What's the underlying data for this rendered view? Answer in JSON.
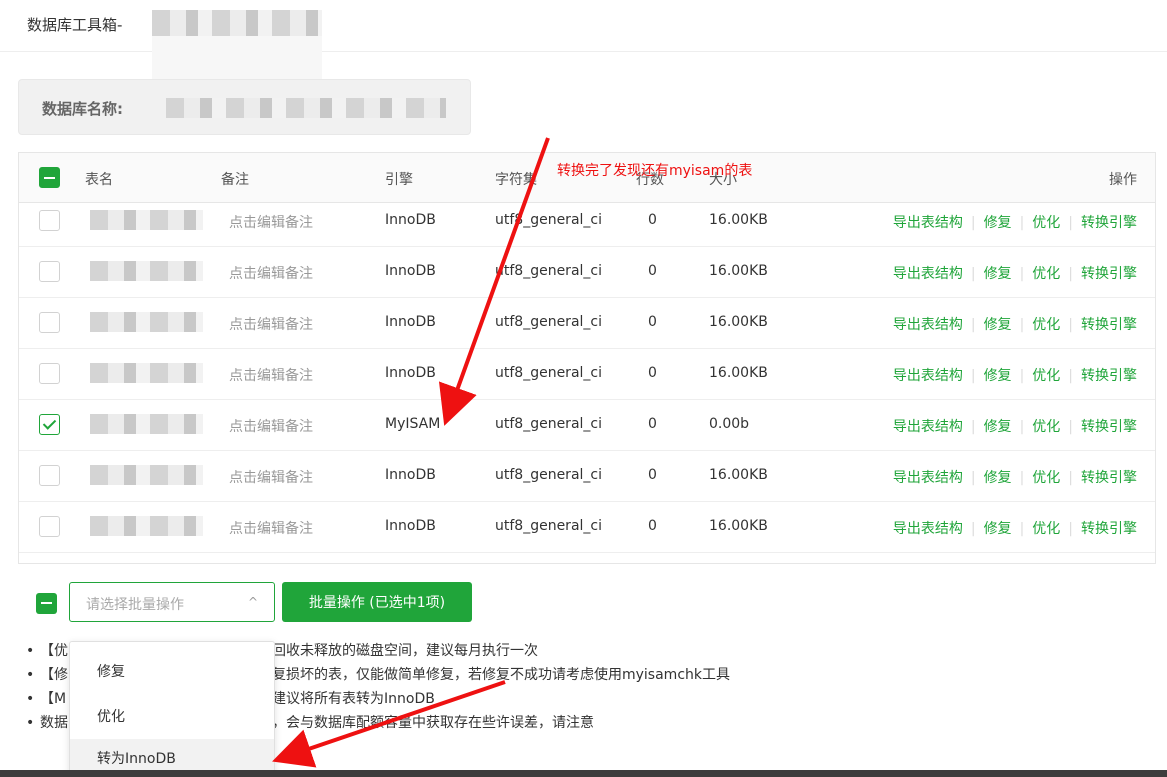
{
  "header": {
    "title": "数据库工具箱-"
  },
  "db_info": {
    "label": "数据库名称:"
  },
  "table": {
    "columns": [
      "表名",
      "备注",
      "引擎",
      "字符集",
      "行数",
      "大小",
      "操作"
    ],
    "rows": [
      {
        "note": "点击编辑备注",
        "engine": "InnoDB",
        "charset": "utf8_general_ci",
        "rows": "0",
        "size": "16.00KB",
        "checked": false
      },
      {
        "note": "点击编辑备注",
        "engine": "InnoDB",
        "charset": "utf8_general_ci",
        "rows": "0",
        "size": "16.00KB",
        "checked": false
      },
      {
        "note": "点击编辑备注",
        "engine": "InnoDB",
        "charset": "utf8_general_ci",
        "rows": "0",
        "size": "16.00KB",
        "checked": false
      },
      {
        "note": "点击编辑备注",
        "engine": "InnoDB",
        "charset": "utf8_general_ci",
        "rows": "0",
        "size": "16.00KB",
        "checked": false
      },
      {
        "note": "点击编辑备注",
        "engine": "MyISAM",
        "charset": "utf8_general_ci",
        "rows": "0",
        "size": "0.00b",
        "checked": true
      },
      {
        "note": "点击编辑备注",
        "engine": "InnoDB",
        "charset": "utf8_general_ci",
        "rows": "0",
        "size": "16.00KB",
        "checked": false
      },
      {
        "note": "点击编辑备注",
        "engine": "InnoDB",
        "charset": "utf8_general_ci",
        "rows": "0",
        "size": "16.00KB",
        "checked": false
      }
    ],
    "actions": [
      "导出表结构",
      "修复",
      "优化",
      "转换引擎"
    ]
  },
  "batch": {
    "select_placeholder": "请选择批量操作",
    "caret": "^",
    "button_label": "批量操作 (已选中1项)",
    "options": [
      "修复",
      "优化",
      "转为InnoDB"
    ]
  },
  "notes": [
    {
      "left": "【优",
      "right": "回收未释放的磁盘空间，建议每月执行一次"
    },
    {
      "left": "【修",
      "right": "复损坏的表，仅能做简单修复，若修复不成功请考虑使用myisamchk工具"
    },
    {
      "left": "【M",
      "right": "建议将所有表转为InnoDB"
    },
    {
      "left": "数据",
      "right": "，会与数据库配额容量中获取存在些许误差，请注意"
    }
  ],
  "annotation": "转换完了发现还有myisam的表",
  "colors": {
    "accent": "#20a53a",
    "annotation": "#ee1111"
  }
}
